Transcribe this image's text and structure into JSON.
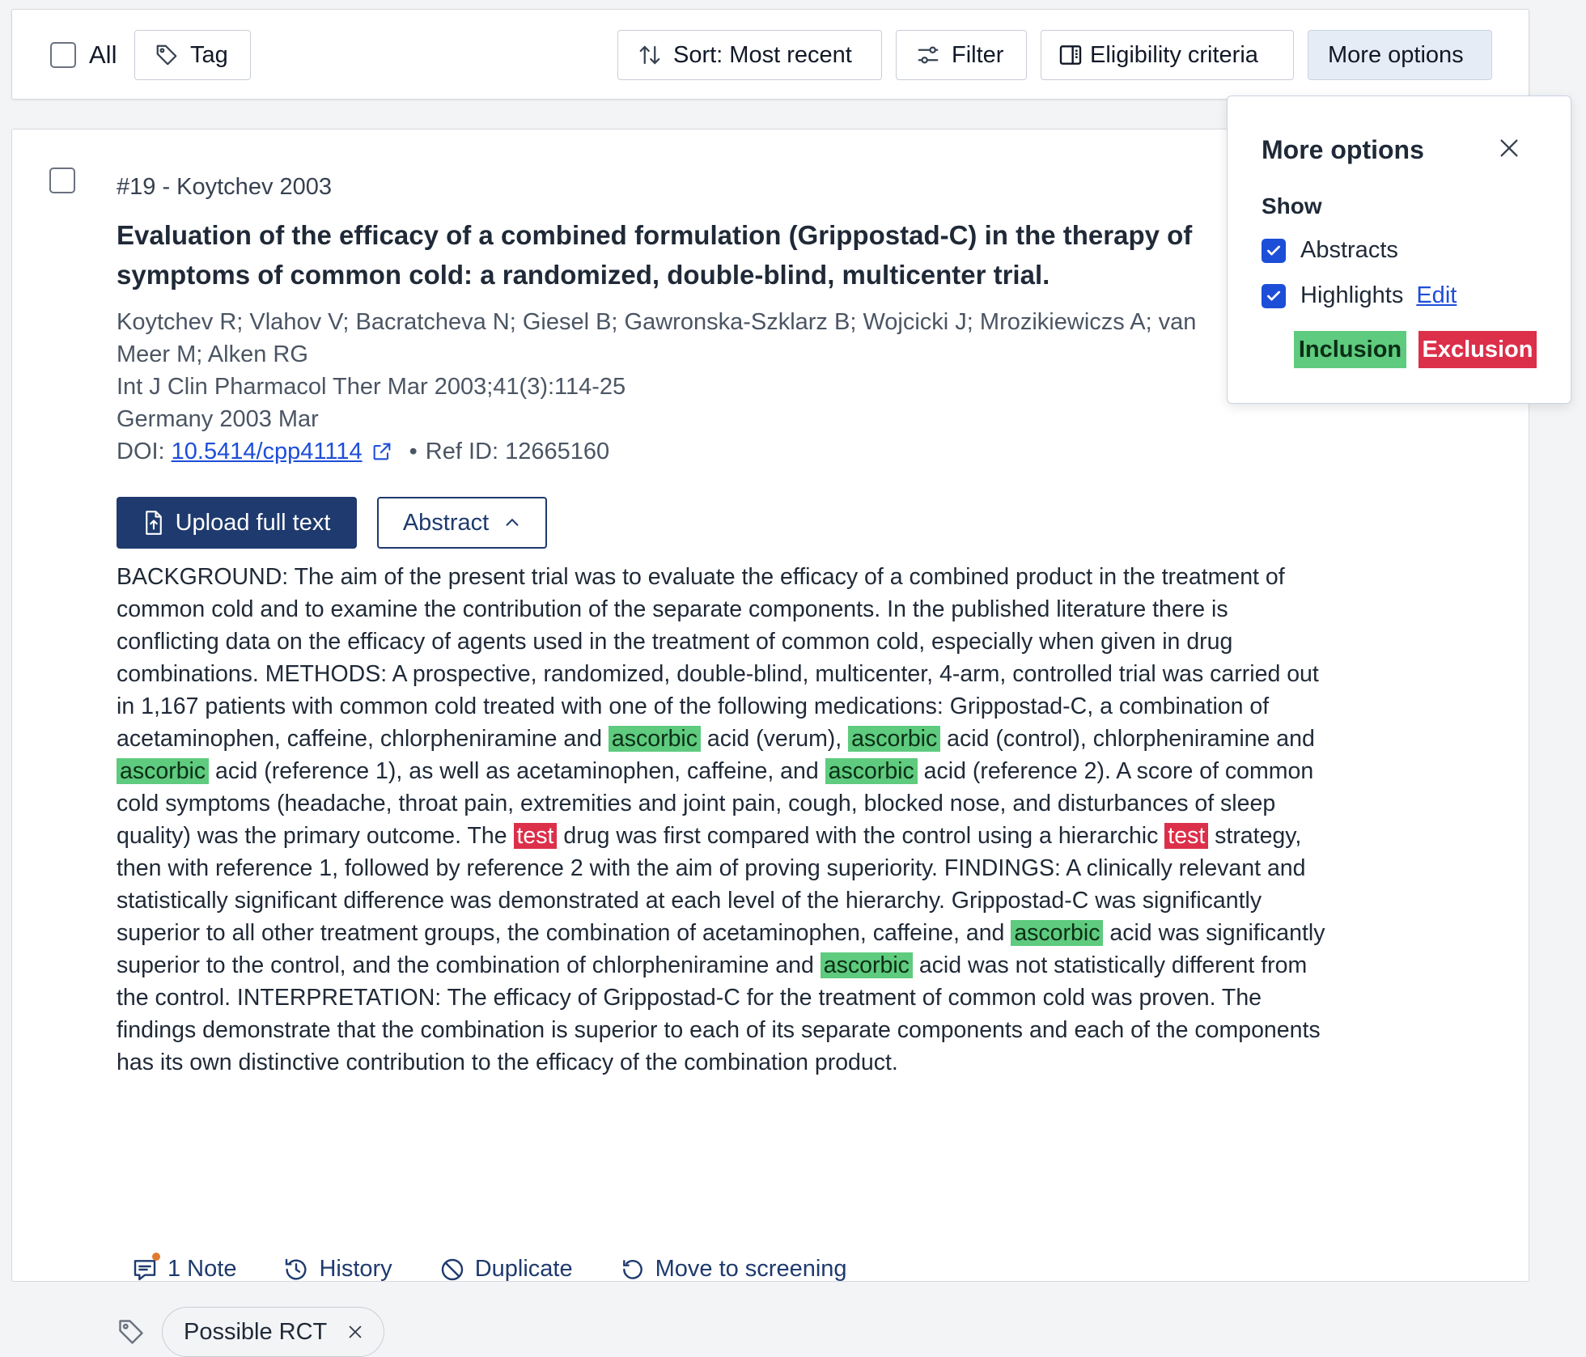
{
  "toolbar": {
    "all_label": "All",
    "tag_label": "Tag",
    "sort_label": "Sort: Most recent",
    "filter_label": "Filter",
    "eligibility_label": "Eligibility criteria",
    "more_options_label": "More options"
  },
  "reference": {
    "number": "#19 - Koytchev 2003",
    "title": "Evaluation of the efficacy of a combined formulation (Grippostad-C) in the therapy of symptoms of common cold: a randomized, double-blind, multicenter trial.",
    "authors": "Koytchev R; Vlahov V; Bacratcheva N; Giesel B; Gawronska-Szklarz B; Wojcicki J; Mrozikiewiczs A; van Meer M; Alken RG",
    "journal": "Int J Clin Pharmacol Ther Mar 2003;41(3):114-25",
    "country_date": "Germany 2003 Mar",
    "doi_prefix": "DOI:",
    "doi": "10.5414/cpp41114",
    "ref_id": "Ref ID: 12665160",
    "upload_label": "Upload full text",
    "abstract_label": "Abstract",
    "abstract_segments": [
      {
        "text": "BACKGROUND: The aim of the present trial was to evaluate the efficacy of a combined product in the treatment of common cold and to examine the contribution of the separate components. In the published literature there is conflicting data on the efficacy of agents used in the treatment of common cold, especially when given in drug combinations. METHODS: A prospective, randomized, double-blind, multicenter, 4-arm, controlled trial was carried out in 1,167 patients with common cold treated with one of the following medications: Grippostad-C, a combination of acetaminophen, caffeine, chlorpheniramine and ",
        "hl": ""
      },
      {
        "text": "ascorbic",
        "hl": "inclusion"
      },
      {
        "text": " acid (verum), ",
        "hl": ""
      },
      {
        "text": "ascorbic",
        "hl": "inclusion"
      },
      {
        "text": " acid (control), chlorpheniramine and ",
        "hl": ""
      },
      {
        "text": "ascorbic",
        "hl": "inclusion"
      },
      {
        "text": " acid (reference 1), as well as acetaminophen, caffeine, and ",
        "hl": ""
      },
      {
        "text": "ascorbic",
        "hl": "inclusion"
      },
      {
        "text": " acid (reference 2). A score of common cold symptoms (headache, throat pain, extremities and joint pain, cough, blocked nose, and disturbances of sleep quality) was the primary outcome. The ",
        "hl": ""
      },
      {
        "text": "test",
        "hl": "exclusion"
      },
      {
        "text": " drug was first compared with the control using a hierarchic ",
        "hl": ""
      },
      {
        "text": "test",
        "hl": "exclusion"
      },
      {
        "text": " strategy, then with reference 1, followed by reference 2 with the aim of proving superiority. FINDINGS: A clinically relevant and statistically significant difference was demonstrated at each level of the hierarchy. Grippostad-C was significantly superior to all other treatment groups, the combination of acetaminophen, caffeine, and ",
        "hl": ""
      },
      {
        "text": "ascorbic",
        "hl": "inclusion"
      },
      {
        "text": " acid was significantly superior to the control, and the combination of chlorpheniramine and ",
        "hl": ""
      },
      {
        "text": "ascorbic",
        "hl": "inclusion"
      },
      {
        "text": " acid was not statistically different from the control. INTERPRETATION: The efficacy of Grippostad-C for the treatment of common cold was proven. The findings demonstrate that the combination is superior to each of its separate components and each of the components has its own distinctive contribution to the efficacy of the combination product.",
        "hl": ""
      }
    ],
    "actions": {
      "note": "1 Note",
      "history": "History",
      "duplicate": "Duplicate",
      "move": "Move to screening"
    },
    "tag": "Possible RCT"
  },
  "more_options": {
    "title": "More options",
    "show_label": "Show",
    "abstracts_label": "Abstracts",
    "abstracts_checked": true,
    "highlights_label": "Highlights",
    "highlights_checked": true,
    "edit_label": "Edit",
    "inclusion_label": "Inclusion",
    "exclusion_label": "Exclusion"
  },
  "colors": {
    "primary": "#1e3a6e",
    "link": "#1d4ed8",
    "inclusion": "#5ecb7e",
    "exclusion": "#dc2f4a",
    "note_dot": "#e07a2f"
  }
}
